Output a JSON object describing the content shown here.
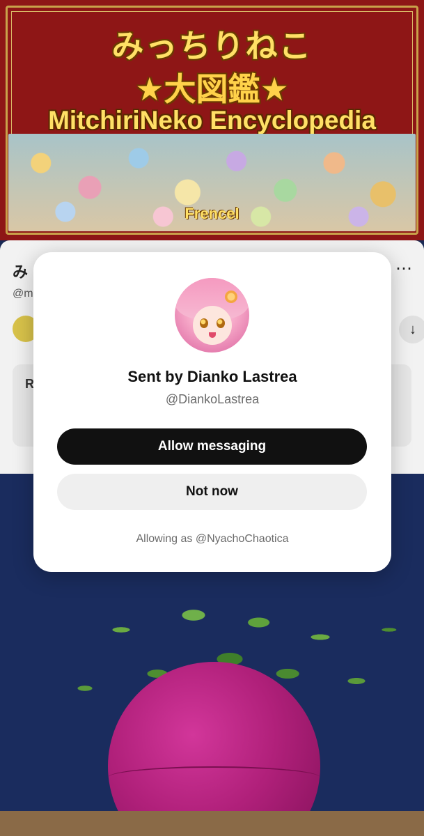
{
  "banner": {
    "title_jp": "みっちりねこ",
    "subtitle_jp": "★大図鑑★",
    "title_en": "MitchiriNeko Encyclopedia",
    "tag": "Frencel"
  },
  "background_sheet": {
    "title_fragment": "み",
    "handle_fragment": "@m",
    "card_letter": "R",
    "more_icon": "more-horizontal-icon",
    "download_icon": "arrow-down-icon"
  },
  "modal": {
    "sent_by": "Sent by Dianko Lastrea",
    "handle": "@DiankoLastrea",
    "allow_button": "Allow messaging",
    "not_now_button": "Not now",
    "allowing_as": "Allowing as @NyachoChaotica"
  }
}
